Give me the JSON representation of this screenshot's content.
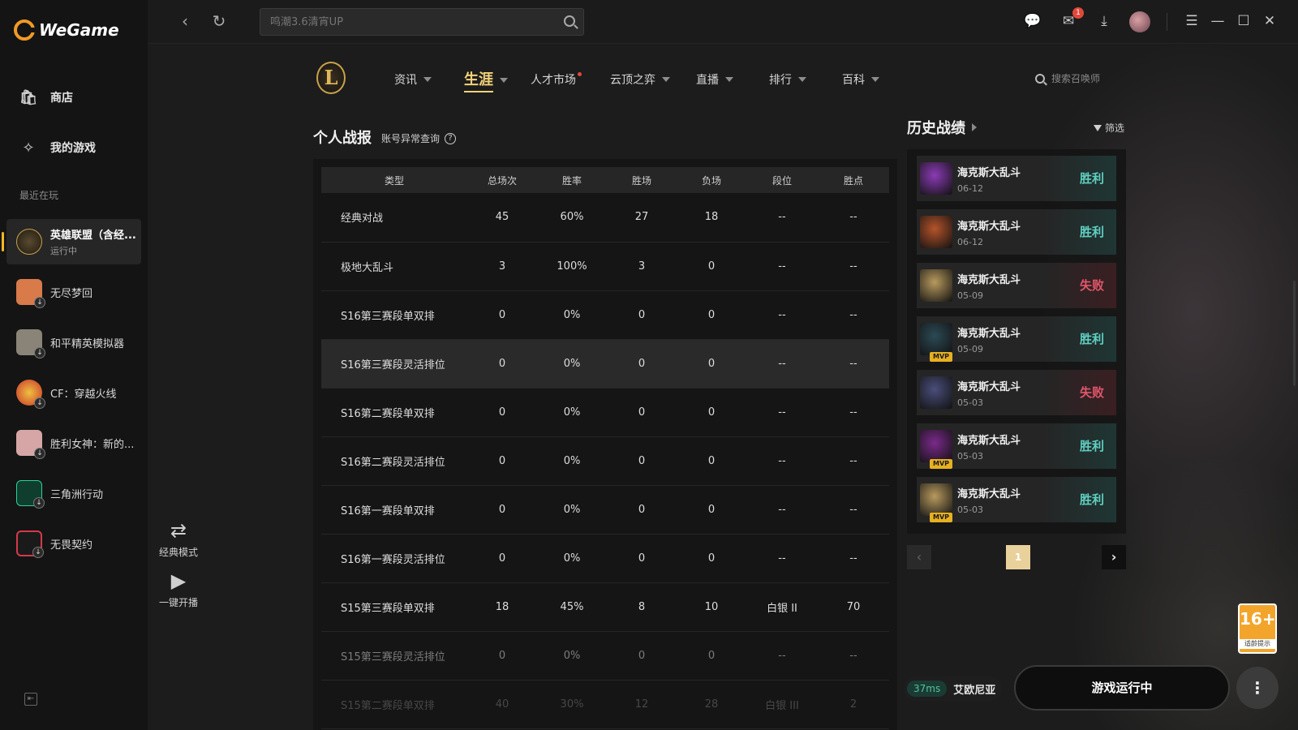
{
  "brand": {
    "name": "WeGame"
  },
  "sidebar": {
    "nav": [
      {
        "label": "商店",
        "icon": "store-bag-icon"
      },
      {
        "label": "我的游戏",
        "icon": "gamepad-icon"
      }
    ],
    "recent_label": "最近在玩",
    "games": [
      {
        "name": "英雄联盟（含经...",
        "status": "运行中",
        "active": true,
        "color": "#3b3324"
      },
      {
        "name": "无尽梦回",
        "color": "#d87a4a"
      },
      {
        "name": "和平精英模拟器",
        "color": "#8a8478"
      },
      {
        "name": "CF：穿越火线",
        "color": "#c8342b"
      },
      {
        "name": "胜利女神：新的...",
        "color": "#d6a6a6"
      },
      {
        "name": "三角洲行动",
        "color": "#0f3d2e"
      },
      {
        "name": "无畏契约",
        "color": "#d33a4a"
      }
    ]
  },
  "topbar": {
    "search_placeholder": "鸣潮3.6清宵UP",
    "mail_count": "1"
  },
  "game_nav": {
    "logo_letter": "L",
    "items": [
      {
        "label": "资讯"
      },
      {
        "label": "生涯",
        "active": true
      },
      {
        "label": "人才市场"
      },
      {
        "label": "云顶之弈"
      },
      {
        "label": "直播"
      },
      {
        "label": "排行"
      },
      {
        "label": "百科"
      }
    ],
    "summoner_search_placeholder": "搜索召唤师"
  },
  "personal": {
    "title": "个人战报",
    "account_link": "账号异常查询",
    "headers": [
      "类型",
      "总场次",
      "胜率",
      "胜场",
      "负场",
      "段位",
      "胜点"
    ],
    "rows": [
      [
        "经典对战",
        "45",
        "60%",
        "27",
        "18",
        "--",
        "--"
      ],
      [
        "极地大乱斗",
        "3",
        "100%",
        "3",
        "0",
        "--",
        "--"
      ],
      [
        "S16第三赛段单双排",
        "0",
        "0%",
        "0",
        "0",
        "--",
        "--"
      ],
      [
        "S16第三赛段灵活排位",
        "0",
        "0%",
        "0",
        "0",
        "--",
        "--"
      ],
      [
        "S16第二赛段单双排",
        "0",
        "0%",
        "0",
        "0",
        "--",
        "--"
      ],
      [
        "S16第二赛段灵活排位",
        "0",
        "0%",
        "0",
        "0",
        "--",
        "--"
      ],
      [
        "S16第一赛段单双排",
        "0",
        "0%",
        "0",
        "0",
        "--",
        "--"
      ],
      [
        "S16第一赛段灵活排位",
        "0",
        "0%",
        "0",
        "0",
        "--",
        "--"
      ],
      [
        "S15第三赛段单双排",
        "18",
        "45%",
        "8",
        "10",
        "白银 II",
        "70"
      ],
      [
        "S15第三赛段灵活排位",
        "0",
        "0%",
        "0",
        "0",
        "--",
        "--"
      ],
      [
        "S15第二赛段单双排",
        "40",
        "30%",
        "12",
        "28",
        "白银 III",
        "2"
      ]
    ]
  },
  "history": {
    "title": "历史战绩",
    "filter_label": "筛选",
    "mvp_label": "MVP",
    "matches": [
      {
        "mode": "海克斯大乱斗",
        "date": "06-12",
        "result": "胜利",
        "win": true,
        "mvp": false,
        "color": "#8b3bb5"
      },
      {
        "mode": "海克斯大乱斗",
        "date": "06-12",
        "result": "胜利",
        "win": true,
        "mvp": false,
        "color": "#b5532a"
      },
      {
        "mode": "海克斯大乱斗",
        "date": "05-09",
        "result": "失败",
        "win": false,
        "mvp": false,
        "color": "#b89a5e"
      },
      {
        "mode": "海克斯大乱斗",
        "date": "05-09",
        "result": "胜利",
        "win": true,
        "mvp": true,
        "color": "#2c4a55"
      },
      {
        "mode": "海克斯大乱斗",
        "date": "05-03",
        "result": "失败",
        "win": false,
        "mvp": false,
        "color": "#4a4e7a"
      },
      {
        "mode": "海克斯大乱斗",
        "date": "05-03",
        "result": "胜利",
        "win": true,
        "mvp": true,
        "color": "#7a2a8a"
      },
      {
        "mode": "海克斯大乱斗",
        "date": "05-03",
        "result": "胜利",
        "win": true,
        "mvp": true,
        "color": "#b89a5e"
      }
    ],
    "page": "1"
  },
  "side_buttons": [
    {
      "label": "经典模式",
      "icon": "swap-icon"
    },
    {
      "label": "一键开播",
      "icon": "video-camera-icon"
    }
  ],
  "bottom": {
    "ping": "37ms",
    "server": "艾欧尼亚",
    "running_label": "游戏运行中",
    "age_rating": "16+",
    "age_note": "适龄提示"
  }
}
